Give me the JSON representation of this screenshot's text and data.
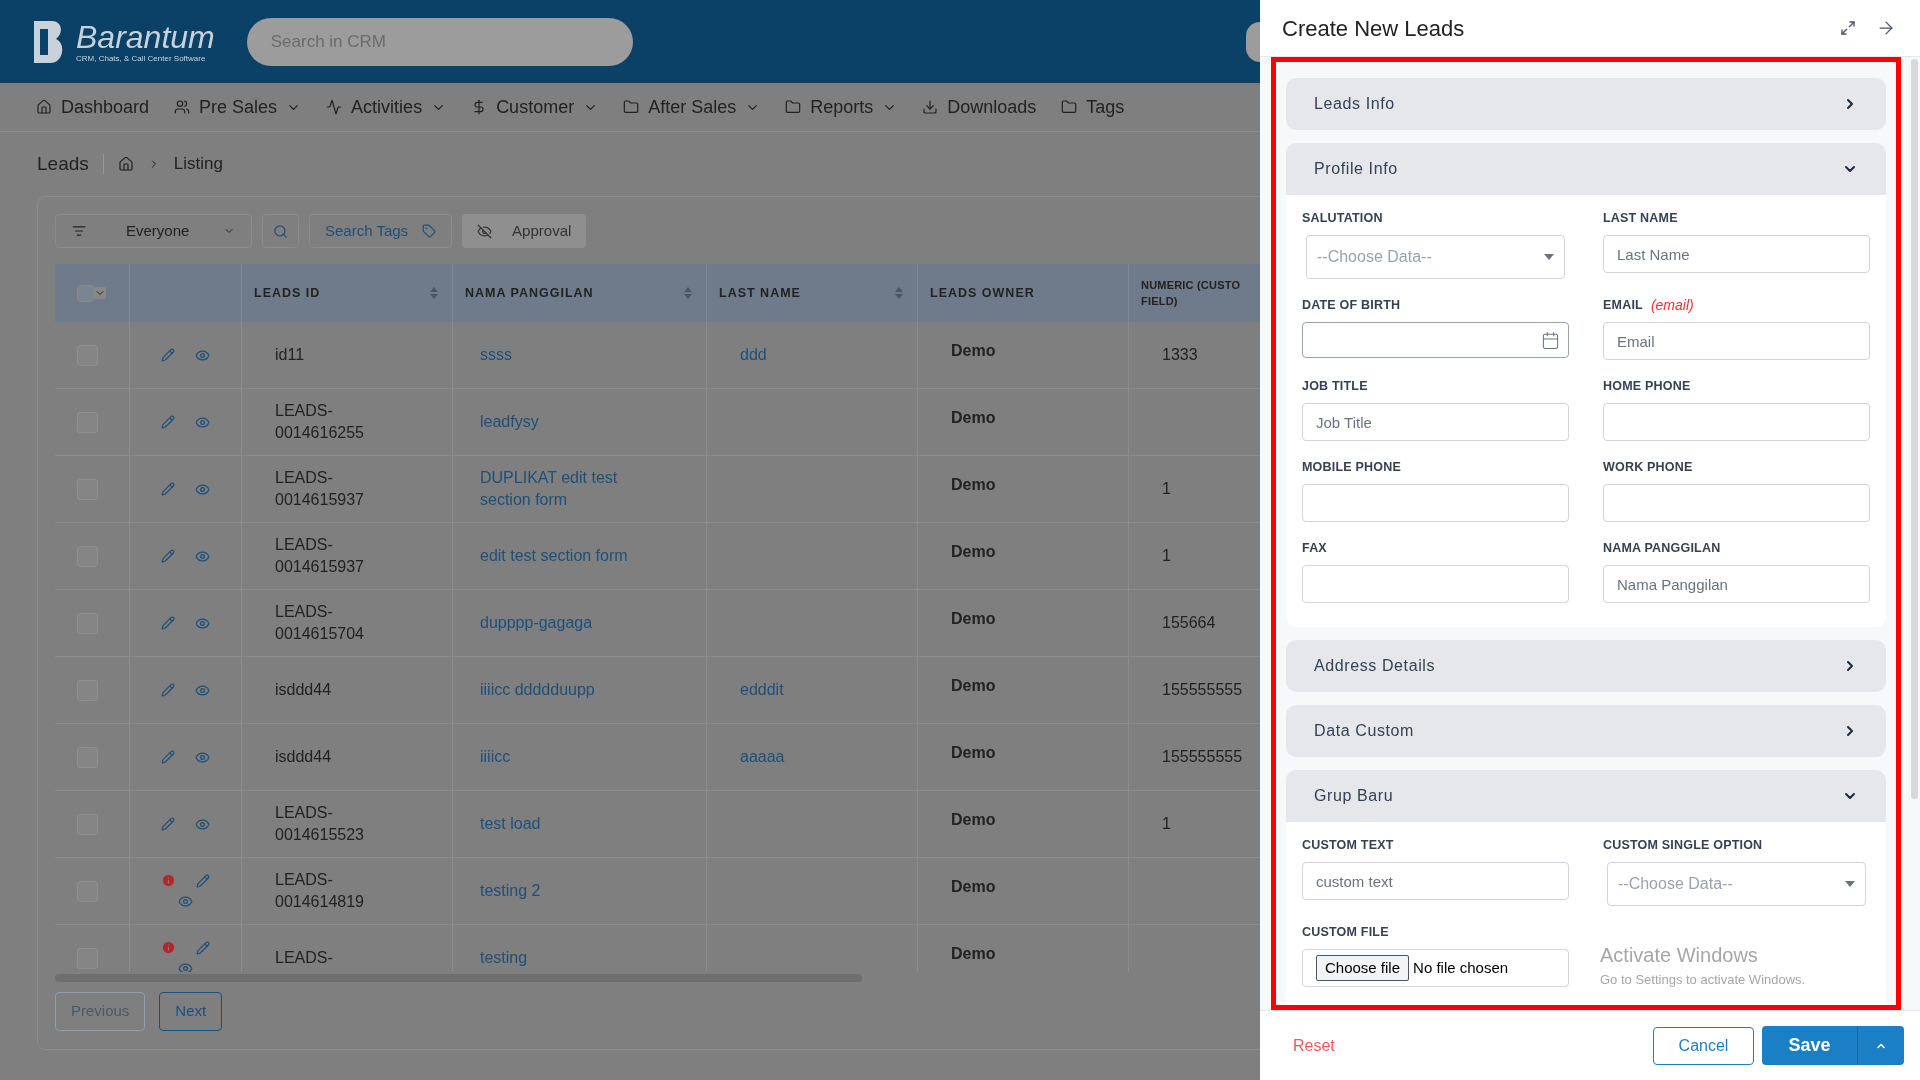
{
  "header": {
    "logo": {
      "name": "Barantum",
      "tagline": "CRM, Chats, & Call Center Software"
    },
    "search": {
      "placeholder": "Search in CRM"
    }
  },
  "nav": [
    {
      "label": "Dashboard",
      "has_menu": false
    },
    {
      "label": "Pre Sales",
      "has_menu": true
    },
    {
      "label": "Activities",
      "has_menu": true
    },
    {
      "label": "Customer",
      "has_menu": true
    },
    {
      "label": "After Sales",
      "has_menu": true
    },
    {
      "label": "Reports",
      "has_menu": true
    },
    {
      "label": "Downloads",
      "has_menu": false
    },
    {
      "label": "Tags",
      "has_menu": false
    }
  ],
  "breadcrumb": {
    "title": "Leads",
    "current": "Listing"
  },
  "toolbar": {
    "filter": "Everyone",
    "tags": "Search Tags",
    "approval": "Approval"
  },
  "table": {
    "select_all": {
      "checked": false
    },
    "columns": [
      {
        "label": "LEADS ID",
        "sortable": true
      },
      {
        "label": "NAMA PANGGILAN",
        "sortable": true
      },
      {
        "label": "LAST NAME",
        "sortable": true
      },
      {
        "label": "LEADS OWNER",
        "sortable": false
      },
      {
        "label": "NUMERIC (CUSTO\nFIELD)",
        "sortable": false
      }
    ],
    "rows": [
      {
        "checked": false,
        "flagged": false,
        "id": "id11",
        "nama": "ssss",
        "last_name": "ddd",
        "owner": "Demo",
        "numeric": "1333"
      },
      {
        "checked": false,
        "flagged": false,
        "id": "LEADS-\n0014616255",
        "nama": "leadfysy",
        "owner": "Demo"
      },
      {
        "checked": false,
        "flagged": false,
        "id": "LEADS-\n0014615937",
        "nama": "DUPLIKAT edit test section form",
        "owner": "Demo",
        "numeric": "1"
      },
      {
        "checked": false,
        "flagged": false,
        "id": "LEADS-\n0014615937",
        "nama": "edit test section form",
        "owner": "Demo",
        "numeric": "1"
      },
      {
        "checked": false,
        "flagged": false,
        "id": "LEADS-\n0014615704",
        "nama": "dupppp-gagaga",
        "owner": "Demo",
        "numeric": "155664"
      },
      {
        "checked": false,
        "flagged": false,
        "id": "isddd44",
        "nama": "iiiicc ddddduupp",
        "last_name": "edddit",
        "owner": "Demo",
        "numeric": "155555555"
      },
      {
        "checked": false,
        "flagged": false,
        "id": "isddd44",
        "nama": "iiiicc",
        "last_name": "aaaaa",
        "owner": "Demo",
        "numeric": "155555555"
      },
      {
        "checked": false,
        "flagged": false,
        "id": "LEADS-\n0014615523",
        "nama": "test load",
        "owner": "Demo",
        "numeric": "1"
      },
      {
        "checked": false,
        "flagged": true,
        "id": "LEADS-\n0014614819",
        "nama": "testing 2",
        "owner": "Demo"
      },
      {
        "checked": false,
        "flagged": true,
        "id": "LEADS-",
        "nama": "testing",
        "owner": "Demo"
      }
    ]
  },
  "pagination": [
    {
      "label": "Previous",
      "disabled": true
    },
    {
      "label": "Next",
      "disabled": false
    }
  ],
  "panel": {
    "title": "Create New Leads",
    "sections": [
      {
        "title": "Leads Info",
        "expanded": false
      },
      {
        "title": "Profile Info",
        "expanded": true,
        "fields": [
          {
            "label": "SALUTATION",
            "kind": "select",
            "placeholder": "--Choose Data--"
          },
          {
            "label": "LAST NAME",
            "kind": "text",
            "placeholder": "Last Name"
          },
          {
            "label": "DATE OF BIRTH",
            "kind": "date"
          },
          {
            "label": "EMAIL",
            "hint": "(email)",
            "kind": "text",
            "placeholder": "Email"
          },
          {
            "label": "JOB TITLE",
            "kind": "text",
            "placeholder": "Job Title"
          },
          {
            "label": "HOME PHONE",
            "kind": "text"
          },
          {
            "label": "MOBILE PHONE",
            "kind": "text"
          },
          {
            "label": "WORK PHONE",
            "kind": "text"
          },
          {
            "label": "FAX",
            "kind": "text"
          },
          {
            "label": "NAMA PANGGILAN",
            "kind": "text",
            "placeholder": "Nama Panggilan"
          }
        ]
      },
      {
        "title": "Address Details",
        "expanded": false
      },
      {
        "title": "Data Custom",
        "expanded": false
      },
      {
        "title": "Grup Baru",
        "expanded": true,
        "fields": [
          {
            "label": "CUSTOM TEXT",
            "kind": "text",
            "placeholder": "custom text"
          },
          {
            "label": "CUSTOM SINGLE OPTION",
            "kind": "select",
            "placeholder": "--Choose Data--"
          },
          {
            "label": "CUSTOM FILE",
            "kind": "file",
            "button": "Choose file",
            "status": "No file chosen"
          }
        ]
      }
    ],
    "footer": {
      "reset": "Reset",
      "cancel": "Cancel",
      "save": "Save"
    }
  },
  "os_notice": {
    "title": "Activate Windows",
    "text": "Go to Settings to activate Windows."
  }
}
